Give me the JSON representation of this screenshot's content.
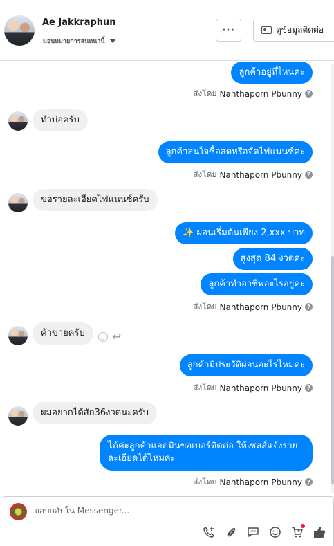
{
  "header": {
    "name": "Ae Jakkraphun",
    "assign_label": "มอบหมายการสนทนานี้",
    "more_label": "···",
    "contact_label": "ดูข้อมูลติดต่อ"
  },
  "messages": {
    "m1": "ลูกค้าอยู่ที่ไหนคะ",
    "m2": "ทำบ่อครับ",
    "m3": "ลูกค้าสนใจซื้อสดหรือจัดไฟแนนซ์คะ",
    "m4": "ขอรายละเอียดไฟแนนซ์ครับ",
    "m5": "✨ ผ่อนเริ่มต้นเพียง 2,xxx บาท",
    "m6": "สูงสุด 84 งวดคะ",
    "m7": "ลูกค้าทำอาชีพอะไรอยู่คะ",
    "m8": "ค้าขายครับ",
    "m9": "ลูกค้ามีประวัติผ่อนอะไรไหมคะ",
    "m10": "ผมอยากได้สัก36งวดนะครับ",
    "m11_line1": "ได้ค่ะลูกค้าแอดมินขอเบอร์ติดต่อ ให้เซลส์แจ้งราย",
    "m11_line2": "ละเอียดได้ไหมคะ"
  },
  "sent_by": {
    "prefix": "ส่งโดย",
    "agent": "Nanthaporn Pbunny",
    "help": "?"
  },
  "composer": {
    "placeholder": "ตอบกลับใน Messenger..."
  },
  "colors": {
    "outgoing": "#0084ff",
    "incoming": "#f1f0f0"
  }
}
